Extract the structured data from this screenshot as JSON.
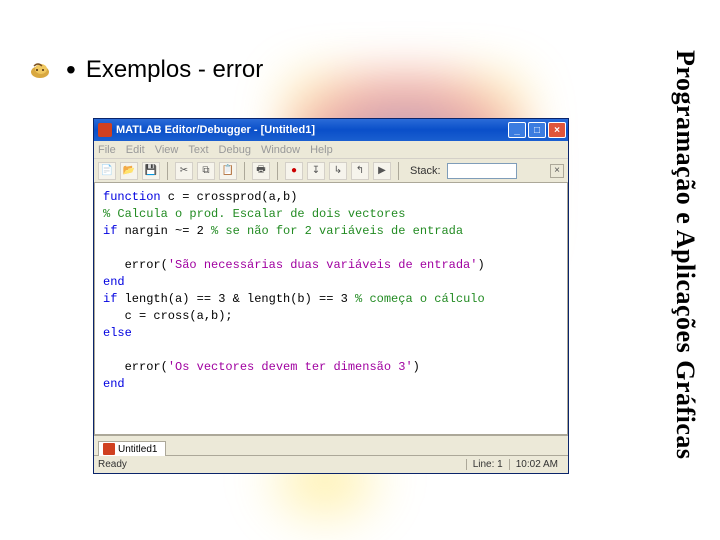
{
  "slide": {
    "title": "Exemplos - error",
    "side_title": "Programação e Aplicações Gráficas"
  },
  "window": {
    "title": "MATLAB Editor/Debugger - [Untitled1]",
    "menu": [
      "File",
      "Edit",
      "View",
      "Text",
      "Debug",
      "Window",
      "Help"
    ],
    "toolbar": {
      "stack_label": "Stack:"
    },
    "tab_label": "Untitled1",
    "status": {
      "left": "Ready",
      "line": "Line: 1",
      "time": "10:02 AM"
    }
  },
  "code": {
    "l1_a": "function",
    "l1_b": " c = crossprod(a,b)",
    "l2": "% Calcula o prod. Escalar de dois vectores",
    "l3_a": "if",
    "l3_b": " nargin ~= 2 ",
    "l3_c": "% se não for 2 variáveis de entrada",
    "l4_a": "   error(",
    "l4_b": "'São necessárias duas variáveis de entrada'",
    "l4_c": ")",
    "l5": "end",
    "l6_a": "if",
    "l6_b": " length(a) == 3 & length(b) == 3 ",
    "l6_c": "% começa o cálculo",
    "l7": "   c = cross(a,b);",
    "l8": "else",
    "l9_a": "   error(",
    "l9_b": "'Os vectores devem ter dimensão 3'",
    "l9_c": ")",
    "l10": "end"
  }
}
